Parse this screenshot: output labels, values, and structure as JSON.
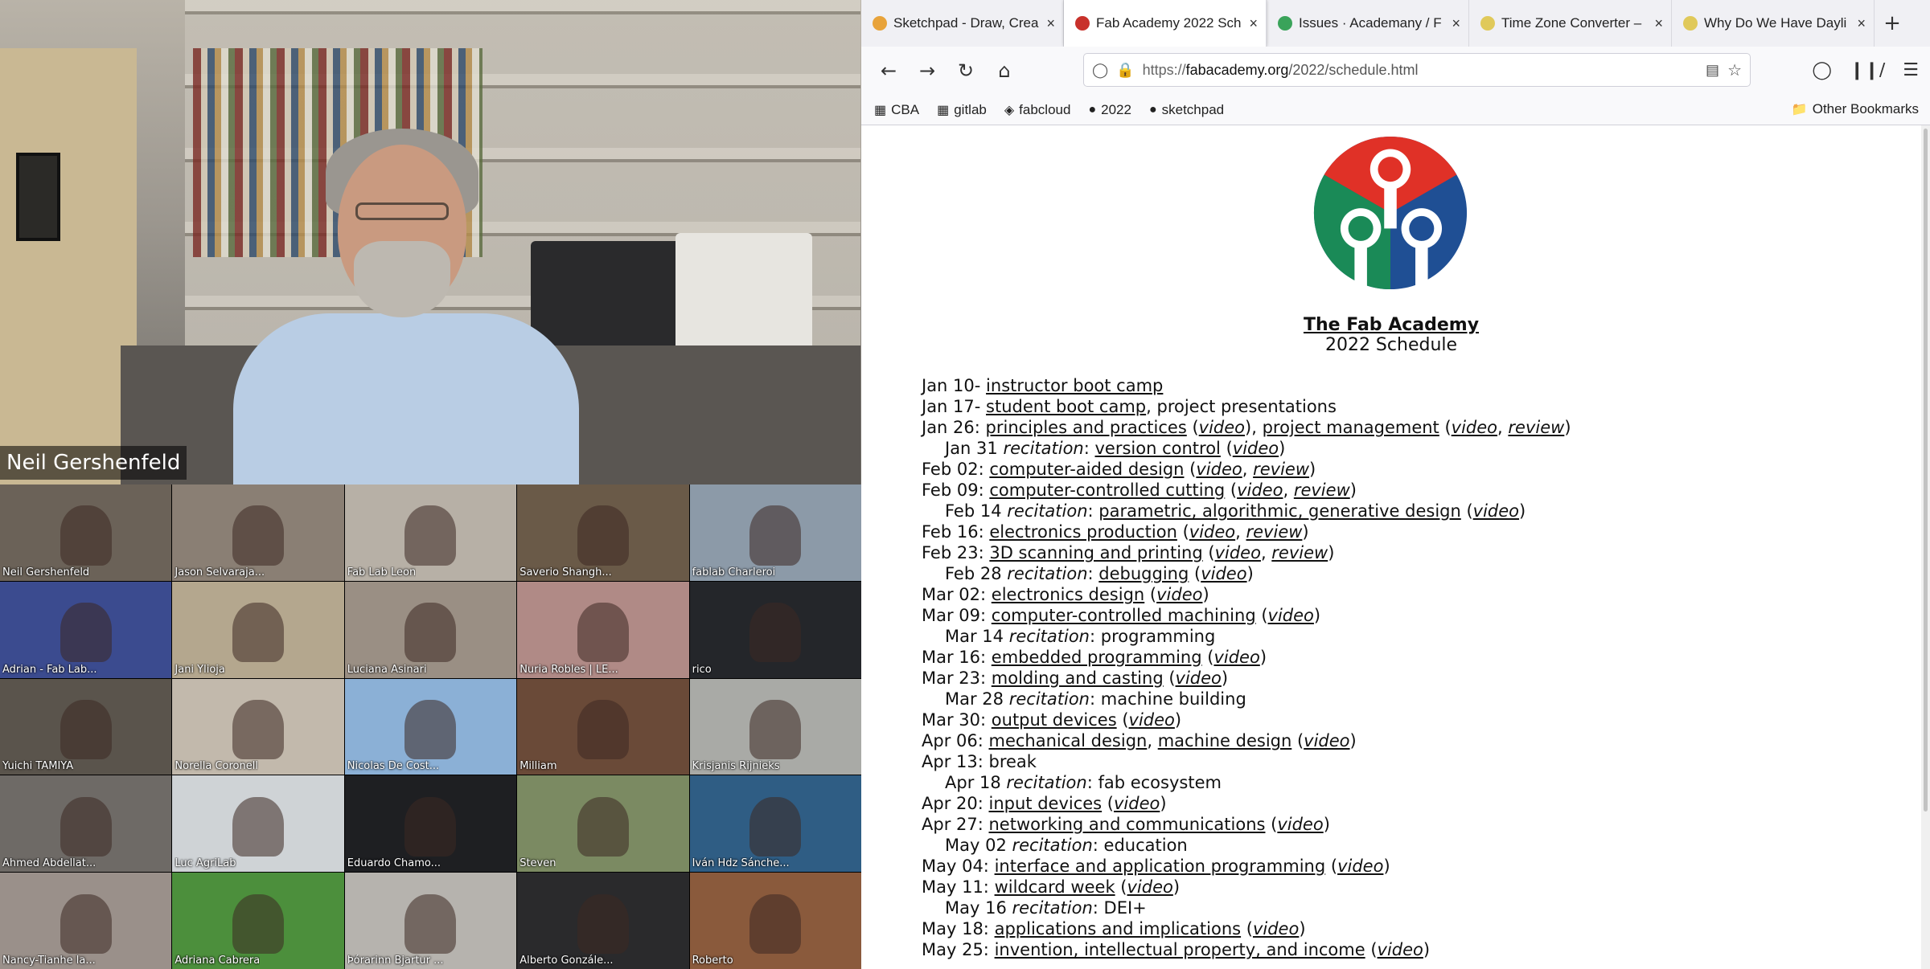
{
  "video": {
    "speaker_name": "Neil Gershenfeld",
    "participants": [
      {
        "name": "Neil Gershenfeld",
        "bg": "#6b6258"
      },
      {
        "name": "Jason Selvaraja...",
        "bg": "#8a7f74"
      },
      {
        "name": "Fab Lab Leon",
        "bg": "#b7b0a6"
      },
      {
        "name": "Saverio Shangh...",
        "bg": "#6a5a48"
      },
      {
        "name": "fablab Charleroi",
        "bg": "#8c9aa8"
      },
      {
        "name": "Adrian - Fab Lab...",
        "bg": "#3b4b8f"
      },
      {
        "name": "Jani Ylioja",
        "bg": "#b4a78e"
      },
      {
        "name": "Luciana Asinari",
        "bg": "#9a8f84"
      },
      {
        "name": "Nuria Robles | LE...",
        "bg": "#b08a86"
      },
      {
        "name": "rico",
        "bg": "#24262a"
      },
      {
        "name": "Yuichi TAMIYA",
        "bg": "#5a544c"
      },
      {
        "name": "Norella Coronell",
        "bg": "#c2b9ac"
      },
      {
        "name": "Nicolas De Cost...",
        "bg": "#8bb0d6"
      },
      {
        "name": "Milliam",
        "bg": "#6a4a38"
      },
      {
        "name": "Krisjanis Rijnieks",
        "bg": "#a9aaa6"
      },
      {
        "name": "Ahmed Abdellat...",
        "bg": "#6e6a66"
      },
      {
        "name": "Luc AgriLab",
        "bg": "#cfd3d6"
      },
      {
        "name": "Eduardo Chamo...",
        "bg": "#1e1f22"
      },
      {
        "name": "Steven",
        "bg": "#7b8a62"
      },
      {
        "name": "Iván Hdz Sánche...",
        "bg": "#2f5d84"
      },
      {
        "name": "Nancy-Tianhe la...",
        "bg": "#9a908a"
      },
      {
        "name": "Adriana Cabrera",
        "bg": "#4c8f3c"
      },
      {
        "name": "Þórarinn Bjartur ...",
        "bg": "#b6b3ae"
      },
      {
        "name": "Alberto Gonzále...",
        "bg": "#2a2a2c"
      },
      {
        "name": "Roberto",
        "bg": "#8a5a3c"
      }
    ]
  },
  "browser": {
    "tabs": [
      {
        "title": "Sketchpad - Draw, Crea",
        "fav": "#e8a33a"
      },
      {
        "title": "Fab Academy 2022 Sch",
        "fav": "#c8312b"
      },
      {
        "title": "Issues · Academany / F",
        "fav": "#3aa35a"
      },
      {
        "title": "Time Zone Converter –",
        "fav": "#e0c95a"
      },
      {
        "title": "Why Do We Have Dayli",
        "fav": "#e0c95a"
      }
    ],
    "new_tab": "+",
    "close_glyph": "×",
    "url_prefix": "https://",
    "url_host": "fabacademy.org",
    "url_path": "/2022/schedule.html",
    "bookmarks": [
      "CBA",
      "gitlab",
      "fabcloud",
      "2022",
      "sketchpad"
    ],
    "other_bookmarks": "Other Bookmarks"
  },
  "page": {
    "title": "The Fab Academy",
    "subtitle": "2022 Schedule",
    "logo_colors": {
      "red": "#e03127",
      "green": "#1a8a57",
      "blue": "#1f4f94"
    },
    "schedule": [
      {
        "date": "Jan 10-",
        "parts": [
          {
            "t": "link",
            "v": "instructor boot camp"
          }
        ]
      },
      {
        "date": "Jan 17-",
        "parts": [
          {
            "t": "link",
            "v": "student boot camp"
          },
          {
            "t": "text",
            "v": ", project presentations"
          }
        ]
      },
      {
        "date": "Jan 26:",
        "parts": [
          {
            "t": "link",
            "v": "principles and practices"
          },
          {
            "t": "text",
            "v": " ("
          },
          {
            "t": "ilink",
            "v": "video"
          },
          {
            "t": "text",
            "v": "), "
          },
          {
            "t": "link",
            "v": "project management"
          },
          {
            "t": "text",
            "v": " ("
          },
          {
            "t": "ilink",
            "v": "video"
          },
          {
            "t": "text",
            "v": ", "
          },
          {
            "t": "ilink",
            "v": "review"
          },
          {
            "t": "text",
            "v": ")"
          }
        ]
      },
      {
        "date": "Jan 31",
        "rec": true,
        "parts": [
          {
            "t": "link",
            "v": "version control"
          },
          {
            "t": "text",
            "v": " ("
          },
          {
            "t": "ilink",
            "v": "video"
          },
          {
            "t": "text",
            "v": ")"
          }
        ]
      },
      {
        "date": "Feb 02:",
        "parts": [
          {
            "t": "link",
            "v": "computer-aided design"
          },
          {
            "t": "text",
            "v": " ("
          },
          {
            "t": "ilink",
            "v": "video"
          },
          {
            "t": "text",
            "v": ", "
          },
          {
            "t": "ilink",
            "v": "review"
          },
          {
            "t": "text",
            "v": ")"
          }
        ]
      },
      {
        "date": "Feb 09:",
        "parts": [
          {
            "t": "link",
            "v": "computer-controlled cutting"
          },
          {
            "t": "text",
            "v": " ("
          },
          {
            "t": "ilink",
            "v": "video"
          },
          {
            "t": "text",
            "v": ", "
          },
          {
            "t": "ilink",
            "v": "review"
          },
          {
            "t": "text",
            "v": ")"
          }
        ]
      },
      {
        "date": "Feb 14",
        "rec": true,
        "parts": [
          {
            "t": "link",
            "v": "parametric, algorithmic, generative design"
          },
          {
            "t": "text",
            "v": " ("
          },
          {
            "t": "ilink",
            "v": "video"
          },
          {
            "t": "text",
            "v": ")"
          }
        ]
      },
      {
        "date": "Feb 16:",
        "parts": [
          {
            "t": "link",
            "v": "electronics production"
          },
          {
            "t": "text",
            "v": " ("
          },
          {
            "t": "ilink",
            "v": "video"
          },
          {
            "t": "text",
            "v": ", "
          },
          {
            "t": "ilink",
            "v": "review"
          },
          {
            "t": "text",
            "v": ")"
          }
        ]
      },
      {
        "date": "Feb 23:",
        "parts": [
          {
            "t": "link",
            "v": "3D scanning and printing"
          },
          {
            "t": "text",
            "v": " ("
          },
          {
            "t": "ilink",
            "v": "video"
          },
          {
            "t": "text",
            "v": ", "
          },
          {
            "t": "ilink",
            "v": "review"
          },
          {
            "t": "text",
            "v": ")"
          }
        ]
      },
      {
        "date": "Feb 28",
        "rec": true,
        "parts": [
          {
            "t": "link",
            "v": "debugging"
          },
          {
            "t": "text",
            "v": " ("
          },
          {
            "t": "ilink",
            "v": "video"
          },
          {
            "t": "text",
            "v": ")"
          }
        ]
      },
      {
        "date": "Mar 02:",
        "parts": [
          {
            "t": "link",
            "v": "electronics design"
          },
          {
            "t": "text",
            "v": " ("
          },
          {
            "t": "ilink",
            "v": "video"
          },
          {
            "t": "text",
            "v": ")"
          }
        ]
      },
      {
        "date": "Mar 09:",
        "parts": [
          {
            "t": "link",
            "v": "computer-controlled machining"
          },
          {
            "t": "text",
            "v": " ("
          },
          {
            "t": "ilink",
            "v": "video"
          },
          {
            "t": "text",
            "v": ")"
          }
        ]
      },
      {
        "date": "Mar 14",
        "rec": true,
        "parts": [
          {
            "t": "text",
            "v": "programming"
          }
        ]
      },
      {
        "date": "Mar 16:",
        "parts": [
          {
            "t": "link",
            "v": "embedded programming"
          },
          {
            "t": "text",
            "v": " ("
          },
          {
            "t": "ilink",
            "v": "video"
          },
          {
            "t": "text",
            "v": ")"
          }
        ]
      },
      {
        "date": "Mar 23:",
        "parts": [
          {
            "t": "link",
            "v": "molding and casting"
          },
          {
            "t": "text",
            "v": " ("
          },
          {
            "t": "ilink",
            "v": "video"
          },
          {
            "t": "text",
            "v": ")"
          }
        ]
      },
      {
        "date": "Mar 28",
        "rec": true,
        "parts": [
          {
            "t": "text",
            "v": "machine building"
          }
        ]
      },
      {
        "date": "Mar 30:",
        "parts": [
          {
            "t": "link",
            "v": "output devices"
          },
          {
            "t": "text",
            "v": " ("
          },
          {
            "t": "ilink",
            "v": "video"
          },
          {
            "t": "text",
            "v": ")"
          }
        ]
      },
      {
        "date": "Apr 06:",
        "parts": [
          {
            "t": "link",
            "v": "mechanical design"
          },
          {
            "t": "text",
            "v": ", "
          },
          {
            "t": "link",
            "v": "machine design"
          },
          {
            "t": "text",
            "v": " ("
          },
          {
            "t": "ilink",
            "v": "video"
          },
          {
            "t": "text",
            "v": ")"
          }
        ]
      },
      {
        "date": "Apr 13:",
        "parts": [
          {
            "t": "text",
            "v": "break"
          }
        ]
      },
      {
        "date": "Apr 18",
        "rec": true,
        "parts": [
          {
            "t": "text",
            "v": "fab ecosystem"
          }
        ]
      },
      {
        "date": "Apr 20:",
        "parts": [
          {
            "t": "link",
            "v": "input devices"
          },
          {
            "t": "text",
            "v": " ("
          },
          {
            "t": "ilink",
            "v": "video"
          },
          {
            "t": "text",
            "v": ")"
          }
        ]
      },
      {
        "date": "Apr 27:",
        "parts": [
          {
            "t": "link",
            "v": "networking and communications"
          },
          {
            "t": "text",
            "v": " ("
          },
          {
            "t": "ilink",
            "v": "video"
          },
          {
            "t": "text",
            "v": ")"
          }
        ]
      },
      {
        "date": "May 02",
        "rec": true,
        "parts": [
          {
            "t": "text",
            "v": "education"
          }
        ]
      },
      {
        "date": "May 04:",
        "parts": [
          {
            "t": "link",
            "v": "interface and application programming"
          },
          {
            "t": "text",
            "v": " ("
          },
          {
            "t": "ilink",
            "v": "video"
          },
          {
            "t": "text",
            "v": ")"
          }
        ]
      },
      {
        "date": "May 11:",
        "parts": [
          {
            "t": "link",
            "v": "wildcard week"
          },
          {
            "t": "text",
            "v": " ("
          },
          {
            "t": "ilink",
            "v": "video"
          },
          {
            "t": "text",
            "v": ")"
          }
        ]
      },
      {
        "date": "May 16",
        "rec": true,
        "parts": [
          {
            "t": "text",
            "v": "DEI+"
          }
        ]
      },
      {
        "date": "May 18:",
        "parts": [
          {
            "t": "link",
            "v": "applications and implications"
          },
          {
            "t": "text",
            "v": " ("
          },
          {
            "t": "ilink",
            "v": "video"
          },
          {
            "t": "text",
            "v": ")"
          }
        ]
      },
      {
        "date": "May 25:",
        "parts": [
          {
            "t": "link",
            "v": "invention, intellectual property, and income"
          },
          {
            "t": "text",
            "v": " ("
          },
          {
            "t": "ilink",
            "v": "video"
          },
          {
            "t": "text",
            "v": ")"
          }
        ]
      }
    ],
    "recitation_word": "recitation"
  }
}
